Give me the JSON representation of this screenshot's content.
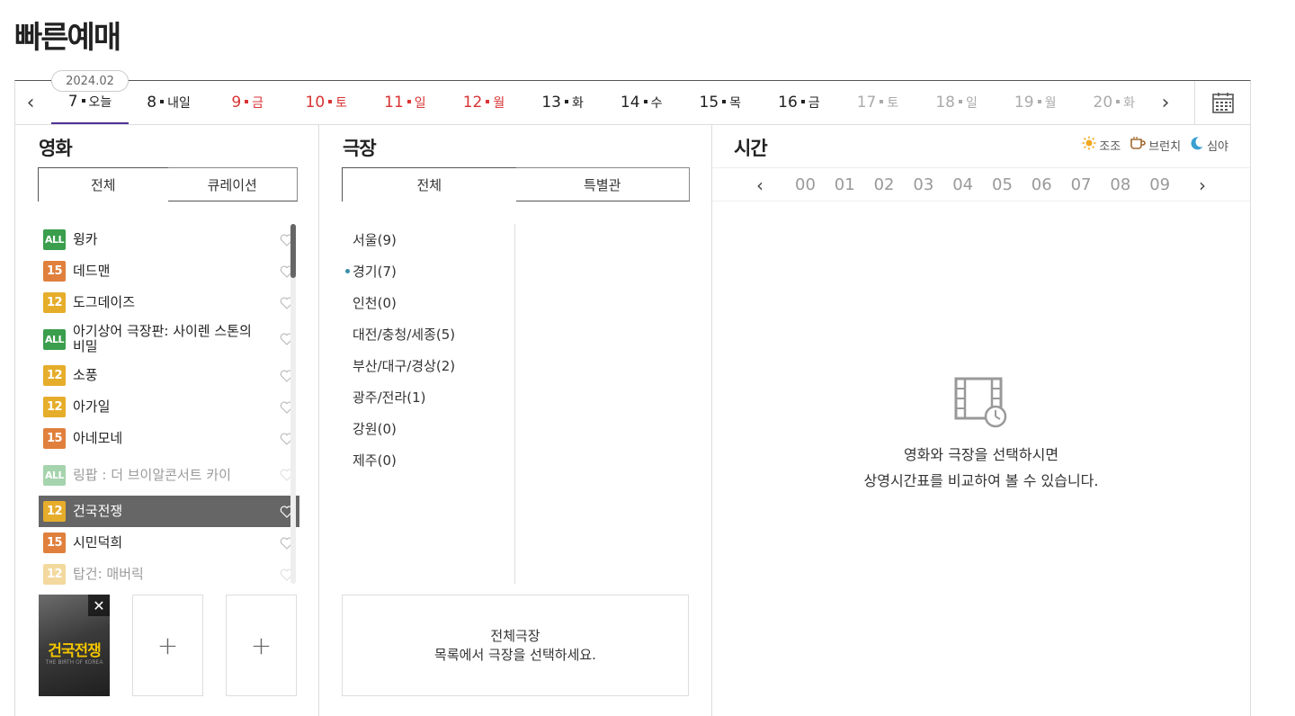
{
  "page_title": "빠른예매",
  "date_bar": {
    "year_month": "2024.02",
    "dates": [
      {
        "num": "7",
        "day": "오늘",
        "color": "#222222",
        "selected": true
      },
      {
        "num": "8",
        "day": "내일",
        "color": "#222222"
      },
      {
        "num": "9",
        "day": "금",
        "color": "#d93333"
      },
      {
        "num": "10",
        "day": "토",
        "color": "#d93333"
      },
      {
        "num": "11",
        "day": "일",
        "color": "#d93333"
      },
      {
        "num": "12",
        "day": "월",
        "color": "#d93333"
      },
      {
        "num": "13",
        "day": "화",
        "color": "#222222"
      },
      {
        "num": "14",
        "day": "수",
        "color": "#222222"
      },
      {
        "num": "15",
        "day": "목",
        "color": "#222222"
      },
      {
        "num": "16",
        "day": "금",
        "color": "#222222"
      },
      {
        "num": "17",
        "day": "토",
        "color": "#aaaaaa"
      },
      {
        "num": "18",
        "day": "일",
        "color": "#aaaaaa"
      },
      {
        "num": "19",
        "day": "월",
        "color": "#aaaaaa"
      },
      {
        "num": "20",
        "day": "화",
        "color": "#aaaaaa"
      }
    ],
    "prev_icon": "chevron-left-icon",
    "next_icon": "chevron-right-icon",
    "calendar_icon": "calendar-icon"
  },
  "movie": {
    "title": "영화",
    "tabs": [
      "전체",
      "큐레이션"
    ],
    "items": [
      {
        "rating": "ALL",
        "name": "윙카"
      },
      {
        "rating": "15",
        "name": "데드맨"
      },
      {
        "rating": "12",
        "name": "도그데이즈"
      },
      {
        "rating": "ALL",
        "name": "아기상어 극장판: 사이렌 스톤의 비밀"
      },
      {
        "rating": "12",
        "name": "소풍"
      },
      {
        "rating": "12",
        "name": "아가일"
      },
      {
        "rating": "15",
        "name": "아네모네"
      },
      {
        "rating": "ALL",
        "name": "링팝 : 더 브이알콘서트 카이",
        "disabled": true
      },
      {
        "rating": "12",
        "name": "건국전쟁",
        "selected": true
      },
      {
        "rating": "15",
        "name": "시민덕희"
      },
      {
        "rating": "12",
        "name": "탑건: 매버릭",
        "disabled": true
      }
    ],
    "selected_poster": {
      "title": "건국전쟁",
      "subtitle": "THE BIRTH OF KOREA"
    },
    "add_slot_label": "+"
  },
  "theater": {
    "title": "극장",
    "tabs": [
      "전체",
      "특별관"
    ],
    "regions": [
      {
        "name": "서울(9)"
      },
      {
        "name": "경기(7)",
        "active": true
      },
      {
        "name": "인천(0)"
      },
      {
        "name": "대전/충청/세종(5)"
      },
      {
        "name": "부산/대구/경상(2)"
      },
      {
        "name": "광주/전라(1)"
      },
      {
        "name": "강원(0)"
      },
      {
        "name": "제주(0)"
      }
    ],
    "notice_line1": "전체극장",
    "notice_line2": "목록에서 극장을 선택하세요."
  },
  "time": {
    "title": "시간",
    "legend": [
      {
        "icon": "sun-icon",
        "label": "조조",
        "color": "#f0a820"
      },
      {
        "icon": "coffee-icon",
        "label": "브런치",
        "color": "#a06a30"
      },
      {
        "icon": "moon-icon",
        "label": "심야",
        "color": "#3aa0d0"
      }
    ],
    "hours": [
      "00",
      "01",
      "02",
      "03",
      "04",
      "05",
      "06",
      "07",
      "08",
      "09"
    ],
    "empty_line1": "영화와 극장을 선택하시면",
    "empty_line2": "상영시간표를 비교하여 볼 수 있습니다."
  }
}
